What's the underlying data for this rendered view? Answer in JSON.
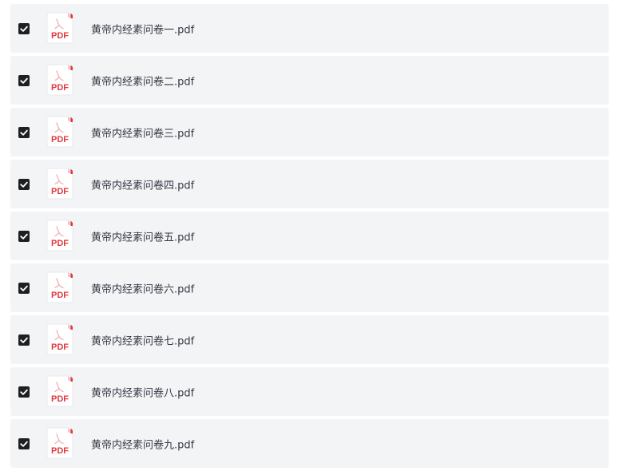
{
  "files": [
    {
      "name": "黄帝内经素问卷一.pdf",
      "checked": true,
      "icon": "pdf-file-icon",
      "icon_label": "PDF"
    },
    {
      "name": "黄帝内经素问卷二.pdf",
      "checked": true,
      "icon": "pdf-file-icon",
      "icon_label": "PDF"
    },
    {
      "name": "黄帝内经素问卷三.pdf",
      "checked": true,
      "icon": "pdf-file-icon",
      "icon_label": "PDF"
    },
    {
      "name": "黄帝内经素问卷四.pdf",
      "checked": true,
      "icon": "pdf-file-icon",
      "icon_label": "PDF"
    },
    {
      "name": "黄帝内经素问卷五.pdf",
      "checked": true,
      "icon": "pdf-file-icon",
      "icon_label": "PDF"
    },
    {
      "name": "黄帝内经素问卷六.pdf",
      "checked": true,
      "icon": "pdf-file-icon",
      "icon_label": "PDF"
    },
    {
      "name": "黄帝内经素问卷七.pdf",
      "checked": true,
      "icon": "pdf-file-icon",
      "icon_label": "PDF"
    },
    {
      "name": "黄帝内经素问卷八.pdf",
      "checked": true,
      "icon": "pdf-file-icon",
      "icon_label": "PDF"
    },
    {
      "name": "黄帝内经素问卷九.pdf",
      "checked": true,
      "icon": "pdf-file-icon",
      "icon_label": "PDF"
    }
  ],
  "colors": {
    "row_background": "#f3f4f6",
    "checkbox_fill": "#1f1f23",
    "pdf_red": "#e0383e",
    "text": "#333842"
  }
}
